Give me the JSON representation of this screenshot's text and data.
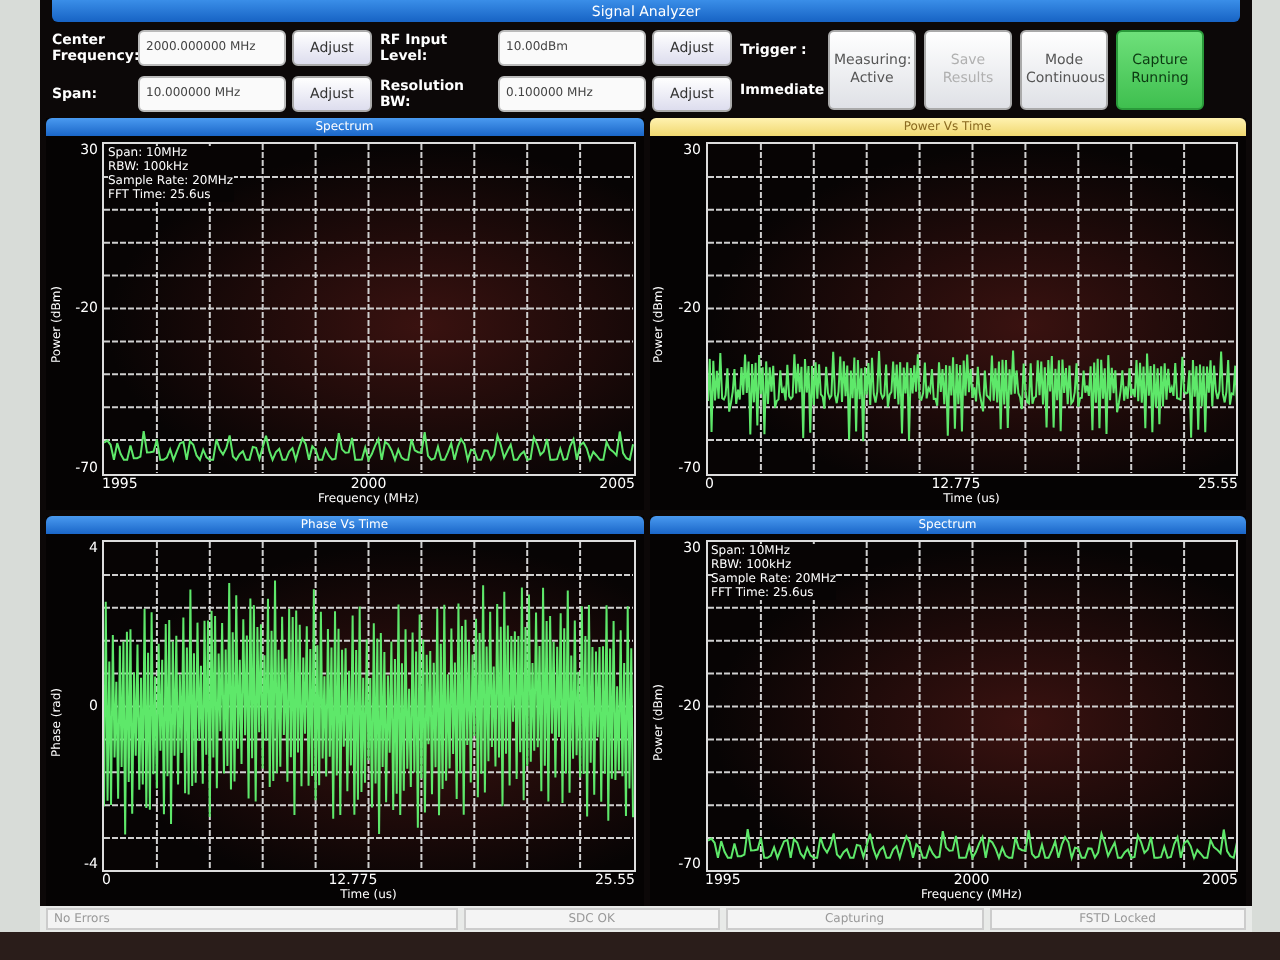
{
  "window": {
    "title": "Signal Analyzer"
  },
  "controls": {
    "fields": [
      {
        "label": "Center Frequency:",
        "value": "2000.000000 MHz",
        "button": "Adjust"
      },
      {
        "label": "Span:",
        "value": "10.000000 MHz",
        "button": "Adjust"
      },
      {
        "label": "RF Input Level:",
        "value": "10.00dBm",
        "button": "Adjust"
      },
      {
        "label": "Resolution BW:",
        "value": "0.100000 MHz",
        "button": "Adjust"
      }
    ],
    "trigger": {
      "label": "Trigger :",
      "value": "Immediate"
    },
    "buttons": [
      {
        "label": "Measuring: Active",
        "disabled": false,
        "active": false
      },
      {
        "label": "Save Results",
        "disabled": true,
        "active": false
      },
      {
        "label": "Mode Continuous",
        "disabled": false,
        "active": false
      },
      {
        "label": "Capture Running",
        "disabled": false,
        "active": true
      }
    ]
  },
  "plots": [
    {
      "title": "Spectrum",
      "selected": false,
      "kind": "spectrum",
      "ylabel": "Power (dBm)",
      "yticks": [
        "30",
        "-20",
        "-70"
      ],
      "xticks": [
        "1995",
        "2000",
        "2005"
      ],
      "xlabel": "Frequency (MHz)",
      "info": [
        "Span: 10MHz",
        "RBW: 100kHz",
        "Sample Rate: 20MHz",
        "FFT Time: 25.6us"
      ]
    },
    {
      "title": "Power Vs Time",
      "selected": true,
      "kind": "power",
      "ylabel": "Power (dBm)",
      "yticks": [
        "30",
        "-20",
        "-70"
      ],
      "xticks": [
        "0",
        "12.775",
        "25.55"
      ],
      "xlabel": "Time (us)"
    },
    {
      "title": "Phase Vs Time",
      "selected": false,
      "kind": "phase",
      "ylabel": "Phase (rad)",
      "yticks": [
        "4",
        "0",
        "-4"
      ],
      "xticks": [
        "0",
        "12.775",
        "25.55"
      ],
      "xlabel": "Time (us)"
    },
    {
      "title": "Spectrum",
      "selected": false,
      "kind": "spectrum",
      "ylabel": "Power (dBm)",
      "yticks": [
        "30",
        "-20",
        "-70"
      ],
      "xticks": [
        "1995",
        "2000",
        "2005"
      ],
      "xlabel": "Frequency (MHz)",
      "info": [
        "Span: 10MHz",
        "RBW: 100kHz",
        "Sample Rate: 20MHz",
        "FFT Time: 25.6us"
      ]
    }
  ],
  "status_bar": [
    "No Errors",
    "SDC OK",
    "Capturing",
    "FSTD Locked"
  ]
}
